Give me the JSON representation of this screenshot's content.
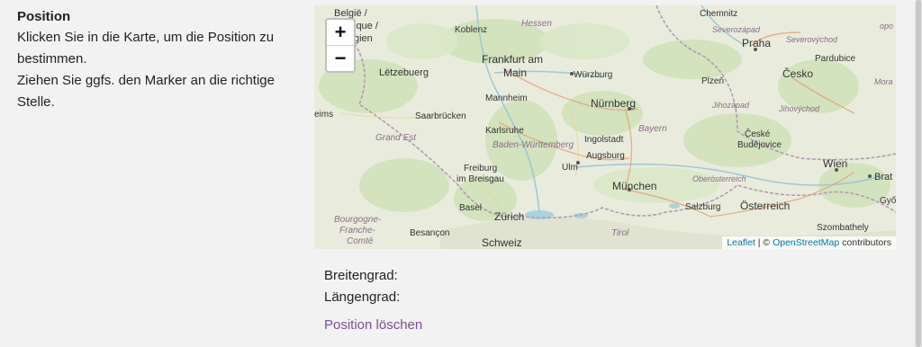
{
  "field": {
    "title": "Position",
    "help_line1": "Klicken Sie in die Karte, um die Position zu bestimmen.",
    "help_line2": "Ziehen Sie ggfs. den Marker an die richtige Stelle."
  },
  "map": {
    "zoom_in": "+",
    "zoom_out": "−",
    "attribution_leaflet": "Leaflet",
    "attribution_sep": " | © ",
    "attribution_osm": "OpenStreetMap",
    "attribution_suffix": " contributors",
    "cities": {
      "chemnitz": "Chemnitz",
      "praha": "Praha",
      "koblenz": "Koblenz",
      "hessen": "Hessen",
      "frankfurt1": "Frankfurt am",
      "frankfurt2": "Main",
      "wuerzburg": "Würzburg",
      "letzebuerg": "Lëtzebuerg",
      "mannheim": "Mannheim",
      "nuernberg": "Nürnberg",
      "plzen": "Plzeň",
      "cesko": "Česko",
      "pardubice": "Pardubice",
      "saarbruecken": "Saarbrücken",
      "karlsruhe": "Karlsruhe",
      "ingolstadt": "Ingolstadt",
      "bayern": "Bayern",
      "grandest": "Grand Est",
      "bw": "Baden-Württemberg",
      "augsburg": "Augsburg",
      "ulm": "Ulm",
      "freiburg1": "Freiburg",
      "freiburg2": "im Breisgau",
      "muenchen": "München",
      "cb1": "České",
      "cb2": "Budějovice",
      "wien": "Wien",
      "basel": "Basel",
      "zuerich": "Zürich",
      "salzburg": "Salzburg",
      "oesterreich": "Österreich",
      "besancon": "Besançon",
      "schweiz": "Schweiz",
      "tirol": "Tirol",
      "szombathely": "Szombathely",
      "bourgogne1": "Bourgogne-",
      "bourgogne2": "Franche-",
      "bourgogne3": "Comté",
      "belgie1": "België /",
      "belgie2": "ique /",
      "belgie3": "gien",
      "reims": "eims",
      "severozapad": "Severozápad",
      "severovychod": "Severovýchod",
      "jihozapad": "Jihozápad",
      "jihovychod": "Jihovýchod",
      "oberoesterreich": "Oberösterreich",
      "brat": "Brat",
      "gyo": "Győ",
      "mora": "Mora",
      "opo": "opo"
    }
  },
  "coords": {
    "lat_label": "Breitengrad:",
    "lng_label": "Längengrad:"
  },
  "actions": {
    "clear_position": "Position löschen"
  }
}
